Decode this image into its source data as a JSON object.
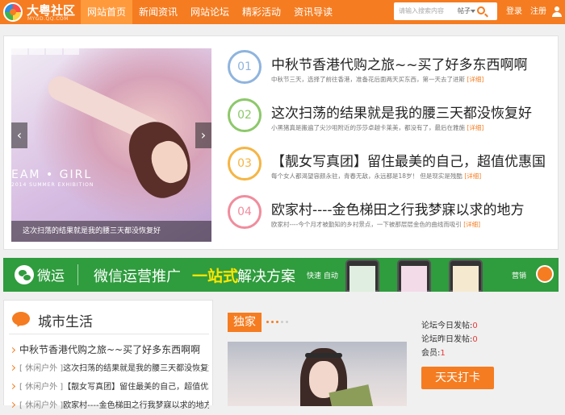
{
  "header": {
    "logo_name": "大粤社区",
    "logo_sub": "MYGD.QQ.COM",
    "nav": [
      "网站首页",
      "新闻资讯",
      "网站论坛",
      "精彩活动",
      "资讯导读"
    ],
    "search_placeholder": "请输入搜索内容",
    "search_scope": "帖子",
    "login": "登录",
    "register": "注册"
  },
  "slider": {
    "watermark": "EAM • GIRL",
    "watermark_sub": "2014 SUMMER EXHIBITION",
    "caption": "这次扫荡的结果就是我的腰三天都没恢复好",
    "prev": "‹",
    "next": "›"
  },
  "news": {
    "more_label": "[详细]",
    "items": [
      {
        "num": "01",
        "color": "#8fb4de",
        "title": "中秋节香港代购之旅~~买了好多东西啊啊",
        "desc": "中秋节三天，选择了前往香港，准备花后面两天买东西，第一天去了进斯"
      },
      {
        "num": "02",
        "color": "#8dc86a",
        "title": "这次扫荡的结果就是我的腰三天都没恢复好",
        "desc": "小黑猪真是搬遍了尖沙咀附近的莎莎卓越卡莱美，都没有了，最后在雅施"
      },
      {
        "num": "03",
        "color": "#f5b544",
        "title": "【靓女写真团】留住最美的自己，超值优惠国",
        "desc": "每个女人都渴望容颜永驻，青春无敌，永远都是18岁！ 但是现实是残酷"
      },
      {
        "num": "04",
        "color": "#f08d9d",
        "title": "欧家村----金色梯田之行我梦寐以求的地方",
        "desc": "欧家村----今个月才被勤知的乡村景点，一下被那层层金色的曲线而吸引"
      }
    ]
  },
  "banner": {
    "brand": "微运",
    "slogan_a": "微信运营推广",
    "slogan_highlight": "一站式",
    "slogan_b": "解决方案",
    "tags": "快速  自动",
    "market": "营销"
  },
  "city": {
    "title": "城市生活",
    "items": [
      {
        "tag": "",
        "text": "中秋节香港代购之旅~~买了好多东西啊啊"
      },
      {
        "tag": "[ 休闲户外 ]",
        "text": "这次扫荡的结果就是我的腰三天都没恢复好"
      },
      {
        "tag": "[ 休闲户外 ]",
        "text": "【靓女写真团】留住最美的自己，超值优惠"
      },
      {
        "tag": "[ 休闲户外 ]",
        "text": "欧家村----金色梯田之行我梦寐以求的地方"
      }
    ]
  },
  "exclusive": {
    "badge": "独家"
  },
  "stats": {
    "today_label": "论坛今日发帖:",
    "today": "0",
    "yesterday_label": "论坛昨日发帖:",
    "yesterday": "0",
    "members_label": "会员:",
    "members": "1"
  },
  "checkin": "天天打卡"
}
